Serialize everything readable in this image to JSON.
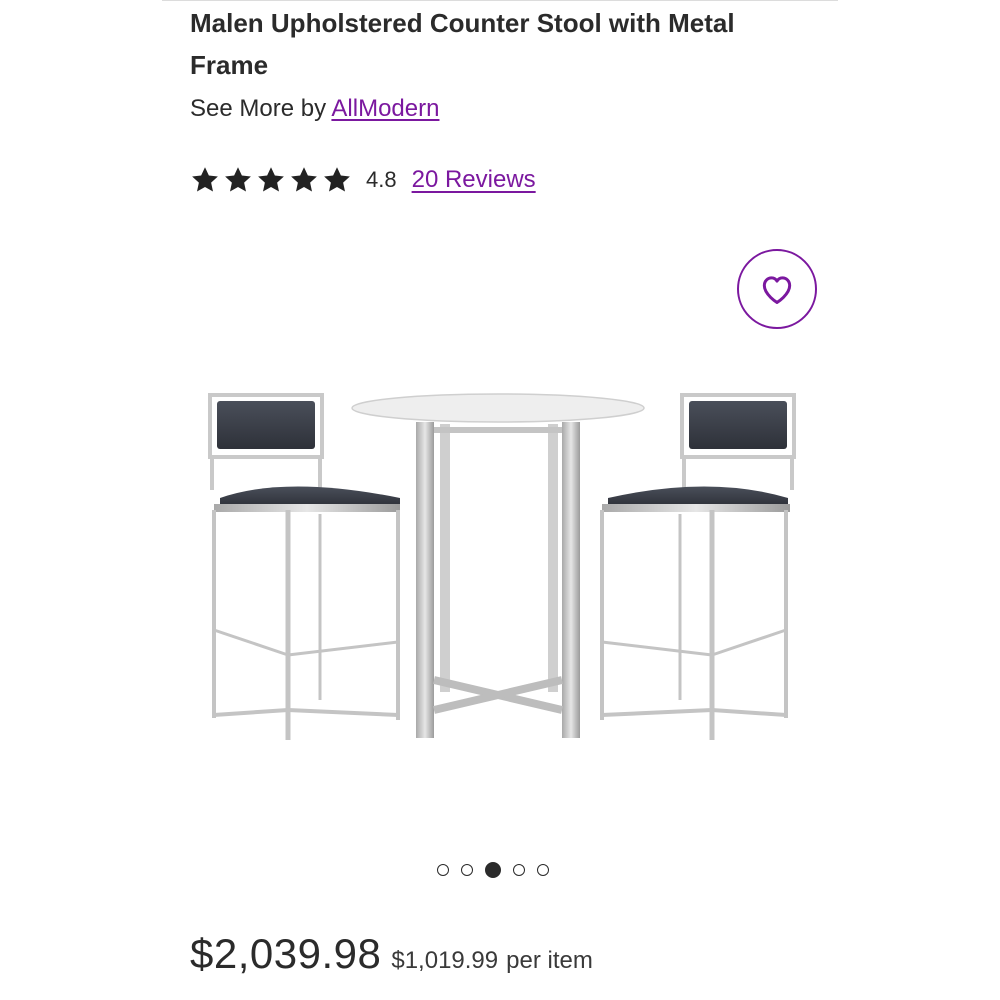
{
  "product": {
    "title": "Malen Upholstered Counter Stool with Metal Frame",
    "brand_prefix": "See More by",
    "brand_name": "AllModern",
    "rating": 4.8,
    "rating_text": "4.8",
    "reviews_text": "20 Reviews",
    "stars_filled": 5
  },
  "gallery": {
    "image_alt": "Malen Upholstered Counter Stool with Metal Frame",
    "dots_count": 5,
    "active_dot": 3,
    "favorite_icon": "heart-outline-icon"
  },
  "pricing": {
    "price": "$2,039.98",
    "unit_price": "$1,019.99",
    "unit_suffix": "per item"
  },
  "colors": {
    "accent": "#7b189f",
    "text": "#2b2b2b"
  }
}
